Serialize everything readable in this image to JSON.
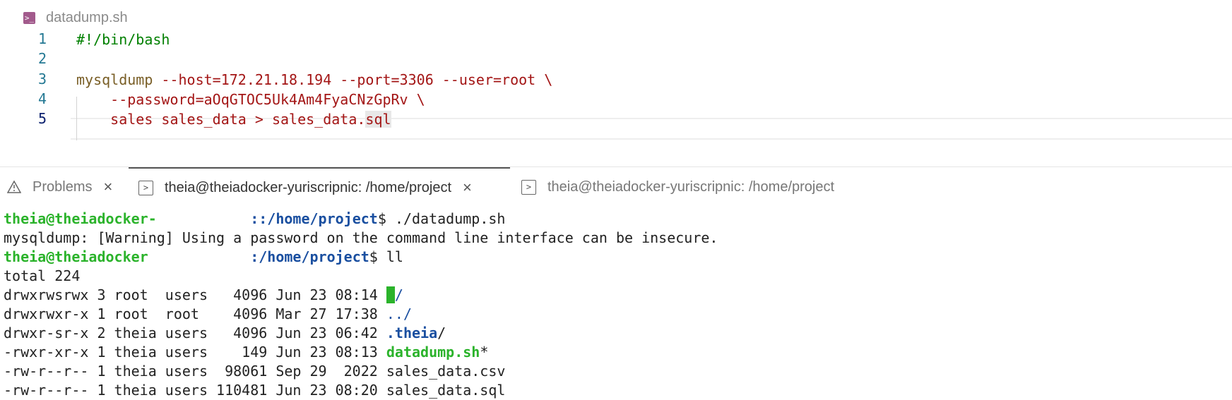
{
  "editor": {
    "file_name": "datadump.sh",
    "lines": [
      {
        "num": "1",
        "text": "#!/bin/bash"
      },
      {
        "num": "2",
        "text": ""
      },
      {
        "num": "3",
        "cmd": "mysqldump",
        "args": " --host=172.21.18.194 --port=3306 --user=root \\"
      },
      {
        "num": "4",
        "text": "    --password=aOqGTOC5Uk4Am4FyaCNzGpRv \\"
      },
      {
        "num": "5",
        "text_pre": "    sales sales_data > sales_data.",
        "text_sel": "sql"
      }
    ]
  },
  "tabs": [
    {
      "label": "Problems",
      "icon": "warning-icon"
    },
    {
      "label": "theia@theiadocker-yuriscripnic: /home/project",
      "icon": "terminal-icon"
    },
    {
      "label": "theia@theiadocker-yuriscripnic: /home/project",
      "icon": "terminal-icon"
    }
  ],
  "terminal": {
    "prompt1": {
      "user": "theia@theiadocker-",
      "host_hidden": "           ",
      "sep": "::",
      "path": "/home/project",
      "dollar": "$ ",
      "command": "./datadump.sh"
    },
    "warning": "mysqldump: [Warning] Using a password on the command line interface can be insecure.",
    "prompt2": {
      "user": "theia@theiadocker",
      "host_hidden": "            ",
      "sep": ":",
      "path": "/home/project",
      "dollar": "$ ",
      "command": "ll"
    },
    "total": "total 224",
    "listing": [
      {
        "meta": "drwxrwsrwx 3 root  users   4096 Jun 23 08:14 ",
        "name": ".",
        "suffix": "/"
      },
      {
        "meta": "drwxrwxr-x 1 root  root    4096 Mar 27 17:38 ",
        "name": "..",
        "suffix": "/"
      },
      {
        "meta": "drwxr-sr-x 2 theia users   4096 Jun 23 06:42 ",
        "name": ".theia",
        "suffix": "/"
      },
      {
        "meta": "-rwxr-xr-x 1 theia users    149 Jun 23 08:13 ",
        "name": "datadump.sh",
        "suffix": "*"
      },
      {
        "meta": "-rw-r--r-- 1 theia users  98061 Sep 29  2022 ",
        "name": "sales_data.csv",
        "suffix": ""
      },
      {
        "meta": "-rw-r--r-- 1 theia users 110481 Jun 23 08:20 ",
        "name": "sales_data.sql",
        "suffix": ""
      }
    ]
  },
  "colors": {
    "prompt_user": "#2bb32b",
    "prompt_path": "#1a4fa0",
    "comment": "#008000",
    "string": "#a31515"
  }
}
